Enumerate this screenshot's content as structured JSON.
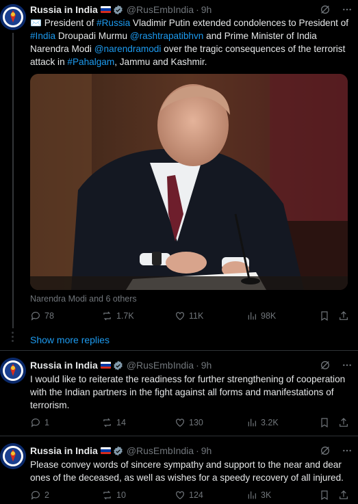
{
  "account": {
    "name": "Russia in India",
    "handle": "@RusEmbIndia"
  },
  "tweets": [
    {
      "time": "9h",
      "text_parts": [
        "✉️ President of ",
        "#Russia",
        " Vladimir Putin extended condolences to President of ",
        "#India",
        " Droupadi Murmu ",
        "@rashtrapatibhvn",
        " and Prime Minister of India Narendra Modi ",
        "@narendramodi",
        " over the tragic consequences of the terrorist attack in ",
        "#Pahalgam",
        ", Jammu and Kashmir."
      ],
      "tagged": "Narendra Modi and 6 others",
      "replies": "78",
      "reposts": "1.7K",
      "likes": "11K",
      "views": "98K"
    },
    {
      "time": "9h",
      "text": "I would like to reiterate the readiness for further strengthening of cooperation with the Indian partners in the fight against all forms and manifestations of terrorism.",
      "replies": "1",
      "reposts": "14",
      "likes": "130",
      "views": "3.2K"
    },
    {
      "time": "9h",
      "text": "Please convey words of sincere sympathy and support to the near and dear ones of the deceased, as well as wishes for a speedy recovery of all injured.",
      "replies": "2",
      "reposts": "10",
      "likes": "124",
      "views": "3K"
    }
  ],
  "show_more": "Show more replies",
  "colors": {
    "accent": "#1d9bf0",
    "muted": "#71767b",
    "text": "#e7e9ea",
    "background": "#000000"
  },
  "icons": [
    "grok-icon",
    "more-icon",
    "reply-icon",
    "repost-icon",
    "like-icon",
    "views-icon",
    "bookmark-icon",
    "share-icon",
    "verified-icon"
  ]
}
